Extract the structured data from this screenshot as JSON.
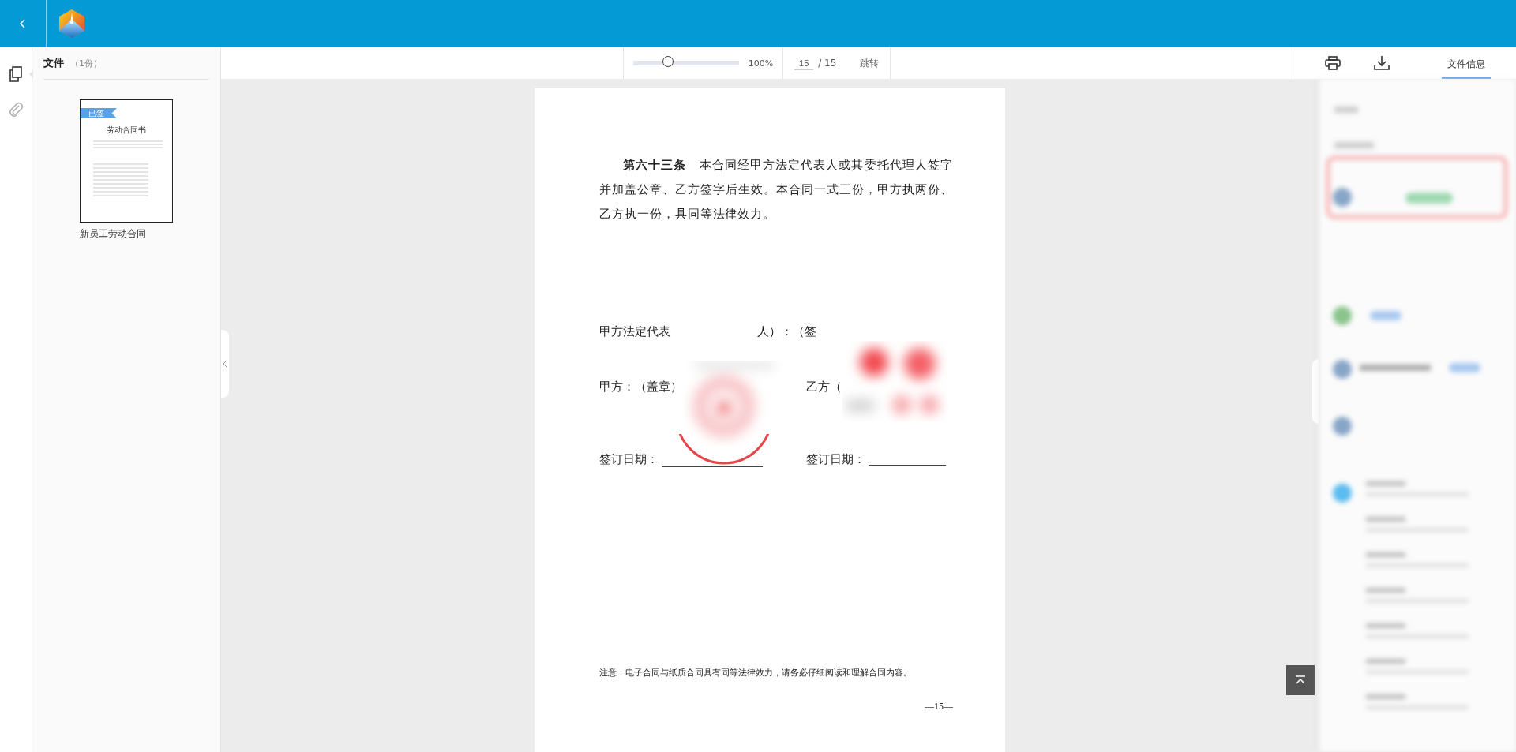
{
  "rail_tabs": [
    {
      "selected": true
    },
    {
      "selected": false
    }
  ],
  "files": {
    "title": "文件",
    "count": "（1份）",
    "items": [
      {
        "name": "新员工劳动合同",
        "badge": "已签",
        "doc_title": "劳动合同书",
        "selected": true
      }
    ]
  },
  "toolbar": {
    "zoom": {
      "level": 0.33,
      "reading": "100%"
    },
    "page": {
      "value": "15",
      "total": "/ 15"
    },
    "jump": "跳转",
    "tabs": [
      {
        "label": "文件信息",
        "selected": true
      }
    ]
  },
  "document": {
    "paragraph": "**第六十三条**　本合同经甲方法定代表人或其委托代理人签字并加盖公章、乙方签字后生效。本合同一式三份，甲方执两份、乙方执一份，具同等法律效力。",
    "rep_label": "甲方法定代表",
    "rep_tail": "人）：（签",
    "party_a": "甲方：（盖章）",
    "party_b": "乙方（",
    "date_a": "签订日期：",
    "date_b": "签订日期：",
    "notice": "注意：电子合同与纸质合同具有同等法律效力，请务必仔细阅读和理解合同内容。",
    "page_number": "—15—"
  }
}
